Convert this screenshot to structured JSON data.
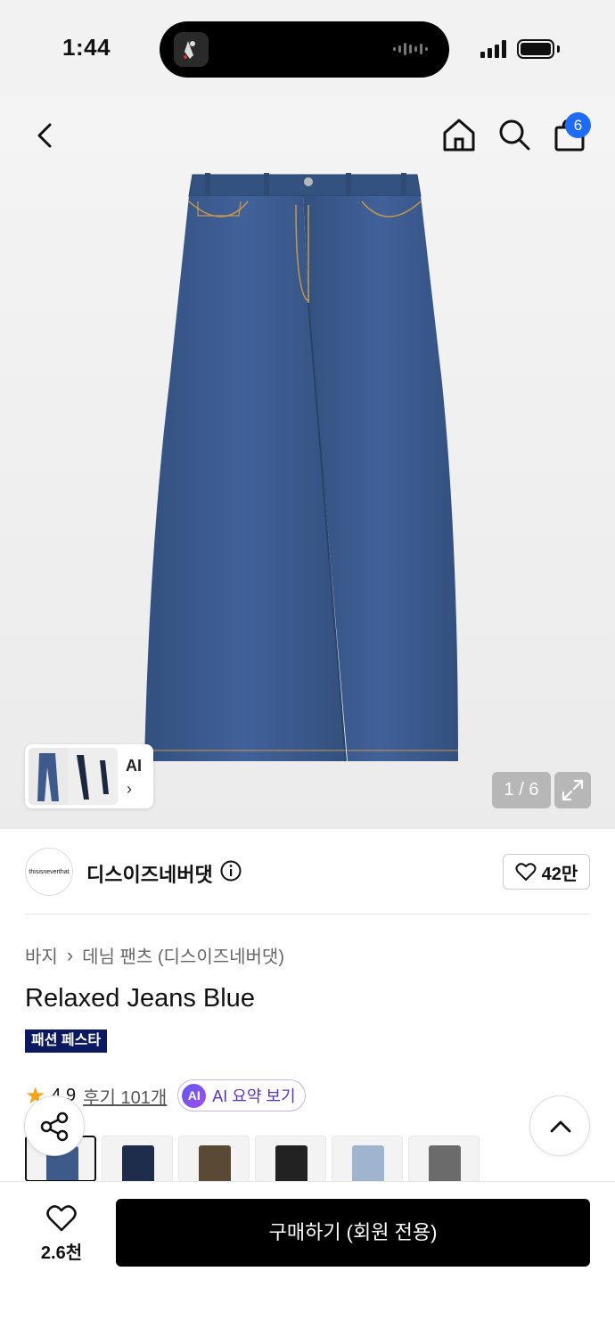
{
  "status": {
    "time": "1:44"
  },
  "colors": {
    "accent_blue": "#1e6bf5",
    "festa_badge": "#0b1a5e",
    "ai_purple": "#5a33c9",
    "star": "#f6a21b",
    "denim": "#3d5a8a"
  },
  "nav": {
    "icons": [
      "back-icon",
      "home-icon",
      "search-icon",
      "shopping-bag-icon"
    ],
    "cart_badge": "6"
  },
  "gallery": {
    "ai_label": "AI",
    "counter": "1 / 6"
  },
  "brand": {
    "logo_text": "thisisneverthat",
    "name": "디스이즈네버댓",
    "likes": "42만"
  },
  "product": {
    "breadcrumb": [
      "바지",
      "데님 팬츠 (디스이즈네버댓)"
    ],
    "title": "Relaxed Jeans Blue",
    "badge": "패션 페스타",
    "rating": "4.9",
    "reviews": "후기 101개",
    "ai_summary_icon": "AI",
    "ai_summary": "AI 요약 보기"
  },
  "swatches": [
    "blue",
    "dark-blue",
    "brown",
    "black",
    "light-blue",
    "gray"
  ],
  "swatch_colors": [
    "#3d5a8a",
    "#1f2d4d",
    "#5a4a35",
    "#222222",
    "#9fb4cf",
    "#6b6b6b"
  ],
  "bottom": {
    "wish_count": "2.6천",
    "buy_label": "구매하기 (회원 전용)"
  }
}
